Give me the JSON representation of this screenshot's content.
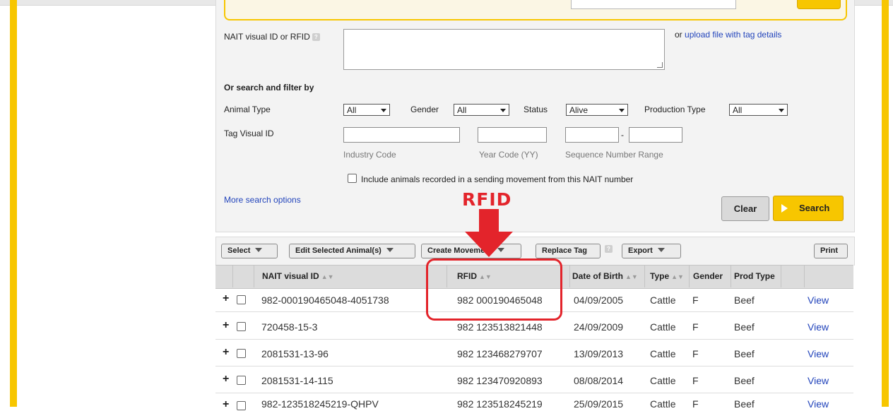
{
  "form": {
    "nait_label": "NAIT visual ID or RFID",
    "help_mark": "?",
    "upload_prefix": "or",
    "upload_link": "upload file with tag details",
    "filter_heading": "Or search and filter by",
    "animal_type_label": "Animal Type",
    "animal_type_value": "All",
    "gender_label": "Gender",
    "gender_value": "All",
    "status_label": "Status",
    "status_value": "Alive",
    "production_type_label": "Production Type",
    "production_type_value": "All",
    "tag_visual_id_label": "Tag Visual ID",
    "industry_code_hint": "Industry Code",
    "year_code_hint": "Year Code (YY)",
    "sequence_hint": "Sequence Number Range",
    "range_dash": "-",
    "include_label": "Include animals recorded in a sending movement from this NAIT number",
    "more_options": "More search options",
    "clear_button": "Clear",
    "search_button": "Search"
  },
  "annotation": {
    "label": "RFID",
    "color": "#e3242b"
  },
  "toolbar": {
    "select": "Select",
    "edit": "Edit Selected Animal(s)",
    "create_movement": "Create Movement",
    "replace_tag": "Replace Tag",
    "help_mark": "?",
    "export": "Export",
    "print": "Print"
  },
  "table": {
    "headers": {
      "visual_id": "NAIT visual ID",
      "rfid": "RFID",
      "dob": "Date of Birth",
      "type": "Type",
      "gender": "Gender",
      "prod_type": "Prod Type"
    },
    "expand_symbol": "+",
    "rows": [
      {
        "visual_id": "982-000190465048-4051738",
        "rfid": "982 000190465048",
        "dob": "04/09/2005",
        "type": "Cattle",
        "gender": "F",
        "prod_type": "Beef",
        "action": "View"
      },
      {
        "visual_id": "720458-15-3",
        "rfid": "982 123513821448",
        "dob": "24/09/2009",
        "type": "Cattle",
        "gender": "F",
        "prod_type": "Beef",
        "action": "View"
      },
      {
        "visual_id": "2081531-13-96",
        "rfid": "982 123468279707",
        "dob": "13/09/2013",
        "type": "Cattle",
        "gender": "F",
        "prod_type": "Beef",
        "action": "View"
      },
      {
        "visual_id": "2081531-14-115",
        "rfid": "982 123470920893",
        "dob": "08/08/2014",
        "type": "Cattle",
        "gender": "F",
        "prod_type": "Beef",
        "action": "View"
      },
      {
        "visual_id": "982-123518245219-QHPV",
        "rfid": "982 123518245219",
        "dob": "25/09/2015",
        "type": "Cattle",
        "gender": "F",
        "prod_type": "Beef",
        "action": "View"
      }
    ]
  },
  "colors": {
    "brand_yellow": "#f7c600",
    "link_blue": "#2244bb",
    "highlight_red": "#e3242b"
  }
}
